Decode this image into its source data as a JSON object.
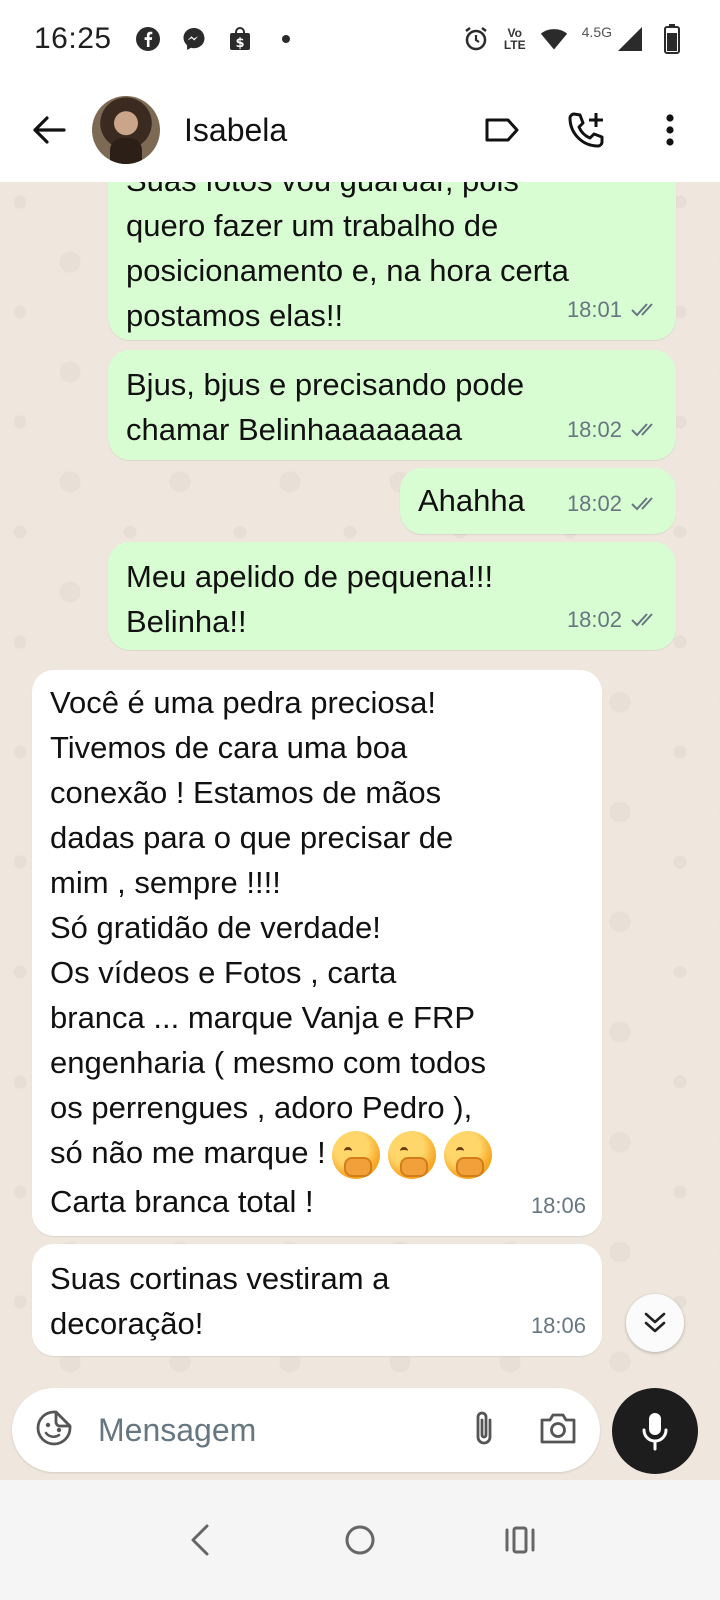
{
  "status_bar": {
    "time": "16:25",
    "icons_left": [
      "facebook-icon",
      "messenger-icon",
      "shop-bag-icon",
      "dot-icon"
    ],
    "icons_right": [
      "alarm-icon",
      "volte-icon",
      "wifi-icon",
      "signal-icon",
      "battery-icon"
    ],
    "volte_top": "Vo",
    "volte_bottom": "LTE",
    "network": "4.5G"
  },
  "header": {
    "contact_name": "Isabela",
    "actions": [
      "label-icon",
      "add-call-icon",
      "more-options-icon"
    ]
  },
  "messages": [
    {
      "direction": "out",
      "text": "Suas fotos vou guardar, pois\nquero fazer um trabalho de\nposicionamento e, na hora certa\npostamos elas!!",
      "time": "18:01",
      "read": true
    },
    {
      "direction": "out",
      "text": "Bjus, bjus e precisando pode\nchamar Belinhaaaaaaaa",
      "time": "18:02",
      "read": true
    },
    {
      "direction": "out",
      "text": "Ahahha",
      "time": "18:02",
      "read": true
    },
    {
      "direction": "out",
      "text": "Meu apelido de pequena!!!\nBelinha!!",
      "time": "18:02",
      "read": true
    },
    {
      "direction": "in",
      "text": "Você é uma pedra preciosa!\nTivemos de cara uma boa\nconexão ! Estamos de mãos\ndadas para o que precisar de\nmim , sempre !!!!\nSó gratidão de verdade!\nOs vídeos e Fotos , carta\nbranca ... marque Vanja e FRP\nengenharia ( mesmo com todos\nos perrengues , adoro Pedro ),\nsó não me marque !",
      "text_after_emoji": "Carta branca total !",
      "emojis": [
        "face-with-hand-over-mouth-icon",
        "face-with-hand-over-mouth-icon",
        "face-with-hand-over-mouth-icon"
      ],
      "time": "18:06"
    },
    {
      "direction": "in",
      "text": "Suas cortinas vestiram a\ndecoração!",
      "time": "18:06"
    }
  ],
  "composer": {
    "placeholder": "Mensagem"
  },
  "colors": {
    "outgoing_bubble": "#d9fdd3",
    "incoming_bubble": "#ffffff",
    "chat_background": "#efe7dd",
    "read_ticks": "#667781",
    "mic_button": "#1d1d1d"
  }
}
